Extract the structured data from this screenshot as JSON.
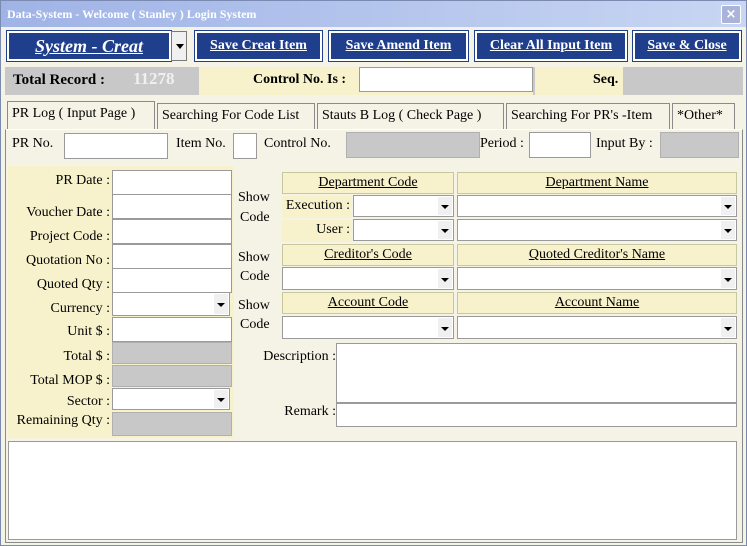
{
  "window": {
    "title": "Data-System - Welcome ( Stanley ) Login System",
    "close_glyph": "×"
  },
  "toolbar": {
    "mode_label": "System - Creat",
    "save_creat": "Save Creat Item",
    "save_amend": "Save Amend Item",
    "clear_all": "Clear All Input Item",
    "save_close": "Save & Close"
  },
  "infobar": {
    "total_record_label": "Total Record :",
    "total_record_value": "11278",
    "control_no_label": "Control No. Is :",
    "control_no_value": "",
    "seq_label": "Seq."
  },
  "tabs": [
    {
      "label": "PR Log ( Input Page )",
      "active": true
    },
    {
      "label": "Searching For Code List",
      "active": false
    },
    {
      "label": "Stauts B Log ( Check Page )",
      "active": false
    },
    {
      "label": "Searching For PR's -Item",
      "active": false
    },
    {
      "label": "*Other*",
      "active": false
    }
  ],
  "header_row": {
    "pr_no_label": "PR No.",
    "item_no_label": "Item No.",
    "control_no_label": "Control No.",
    "period_label": "Period :",
    "input_by_label": "Input By :"
  },
  "left_form": {
    "pr_date": "PR Date :",
    "voucher_date": "Voucher Date :",
    "project_code": "Project Code :",
    "quotation_no": "Quotation No :",
    "quoted_qty": "Quoted Qty :",
    "currency": "Currency :",
    "unit": "Unit $ :",
    "total": "Total $ :",
    "total_mop": "Total MOP $ :",
    "sector": "Sector :",
    "remaining_qty": "Remaining Qty :"
  },
  "codes": {
    "show_code_1": "Show",
    "show_code_2": "Code",
    "department_code": "Department  Code",
    "department_name": "Department Name",
    "execution": "Execution :",
    "user": "User :",
    "creditor_code": "Creditor's Code",
    "quoted_creditor_name": "Quoted Creditor's Name",
    "account_code": "Account Code",
    "account_name": "Account Name"
  },
  "notes": {
    "description": "Description :",
    "remark": "Remark :"
  },
  "colors": {
    "toolbar_blue": "#1f3f8c",
    "cream": "#f7f2cc",
    "gray_field": "#c8c8c8"
  }
}
